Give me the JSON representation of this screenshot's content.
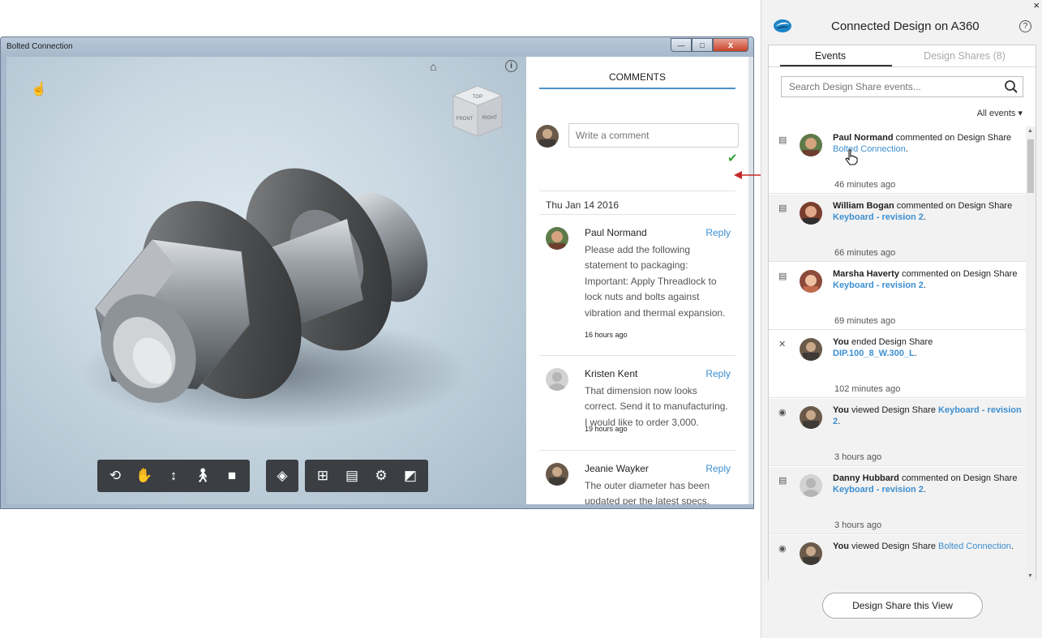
{
  "window": {
    "title": "Bolted Connection",
    "controls": {
      "minimize": "—",
      "maximize": "□",
      "close": "x"
    }
  },
  "viewport": {
    "viewcube": {
      "top": "TOP",
      "front": "FRONT",
      "right": "RIGHT"
    },
    "icons": [
      "home-icon",
      "info-icon",
      "touch-icon"
    ],
    "toolbar_groups": [
      [
        "orbit-icon",
        "pan-icon",
        "zoom-icon",
        "walk-icon",
        "camera-icon"
      ],
      [
        "explode-icon"
      ],
      [
        "model-browser-icon",
        "properties-icon",
        "settings-icon",
        "fullscreen-icon"
      ]
    ]
  },
  "comments": {
    "title": "COMMENTS",
    "input_placeholder": "Write a comment",
    "date": "Thu Jan 14 2016",
    "reply_label": "Reply",
    "items": [
      {
        "author": "Paul Normand",
        "text": "Please add the following statement to packaging:  Important: Apply Threadlock to lock nuts and bolts against vibration and thermal expansion.",
        "time": "16 hours ago"
      },
      {
        "author": "Kristen Kent",
        "text": "That dimension now looks correct. Send it to manufacturing. I would like to order 3,000.",
        "time": "19 hours ago"
      },
      {
        "author": "Jeanie Wayker",
        "text": "The outer diameter has been updated per the latest specs.",
        "time": ""
      }
    ]
  },
  "panel": {
    "close": "×",
    "title": "Connected Design on A360",
    "help": "?",
    "tabs": {
      "events": "Events",
      "shares": "Design Shares (8)"
    },
    "search_placeholder": "Search Design Share events...",
    "filter": "All events ▾",
    "events": [
      {
        "icon": "comment-icon",
        "actor": "Paul Normand",
        "action": " commented on Design Share ",
        "target": "Bolted Connection",
        "suffix": ".",
        "time": "46 minutes ago"
      },
      {
        "icon": "comment-icon",
        "actor": "William Bogan",
        "action": " commented on Design Share ",
        "target": "Keyboard - revision 2",
        "suffix": ".",
        "time": "66 minutes ago"
      },
      {
        "icon": "comment-icon",
        "actor": "Marsha Haverty",
        "action": " commented on Design Share ",
        "target": "Keyboard - revision 2",
        "suffix": ".",
        "time": "69 minutes ago"
      },
      {
        "icon": "ended-icon",
        "actor": "You",
        "action": " ended Design Share ",
        "target": "DIP.100_8_W.300_L",
        "suffix": ".",
        "time": "102 minutes ago"
      },
      {
        "icon": "view-icon",
        "actor": "You",
        "action": " viewed Design Share ",
        "target": "Keyboard - revision 2",
        "suffix": ".",
        "time": "3 hours ago"
      },
      {
        "icon": "comment-icon",
        "actor": "Danny Hubbard",
        "action": " commented on Design Share ",
        "target": "Keyboard - revision 2",
        "suffix": ".",
        "time": "3 hours ago"
      },
      {
        "icon": "view-icon",
        "actor": "You",
        "action": " viewed Design Share ",
        "target": "Bolted Connection",
        "suffix": ".",
        "time": ""
      }
    ],
    "share_button": "Design Share this View"
  },
  "colors": {
    "accent_blue": "#3d8fd0",
    "check_green": "#35a335",
    "arrow_red": "#c62828",
    "toolbar_bg": "#3b3e42"
  }
}
